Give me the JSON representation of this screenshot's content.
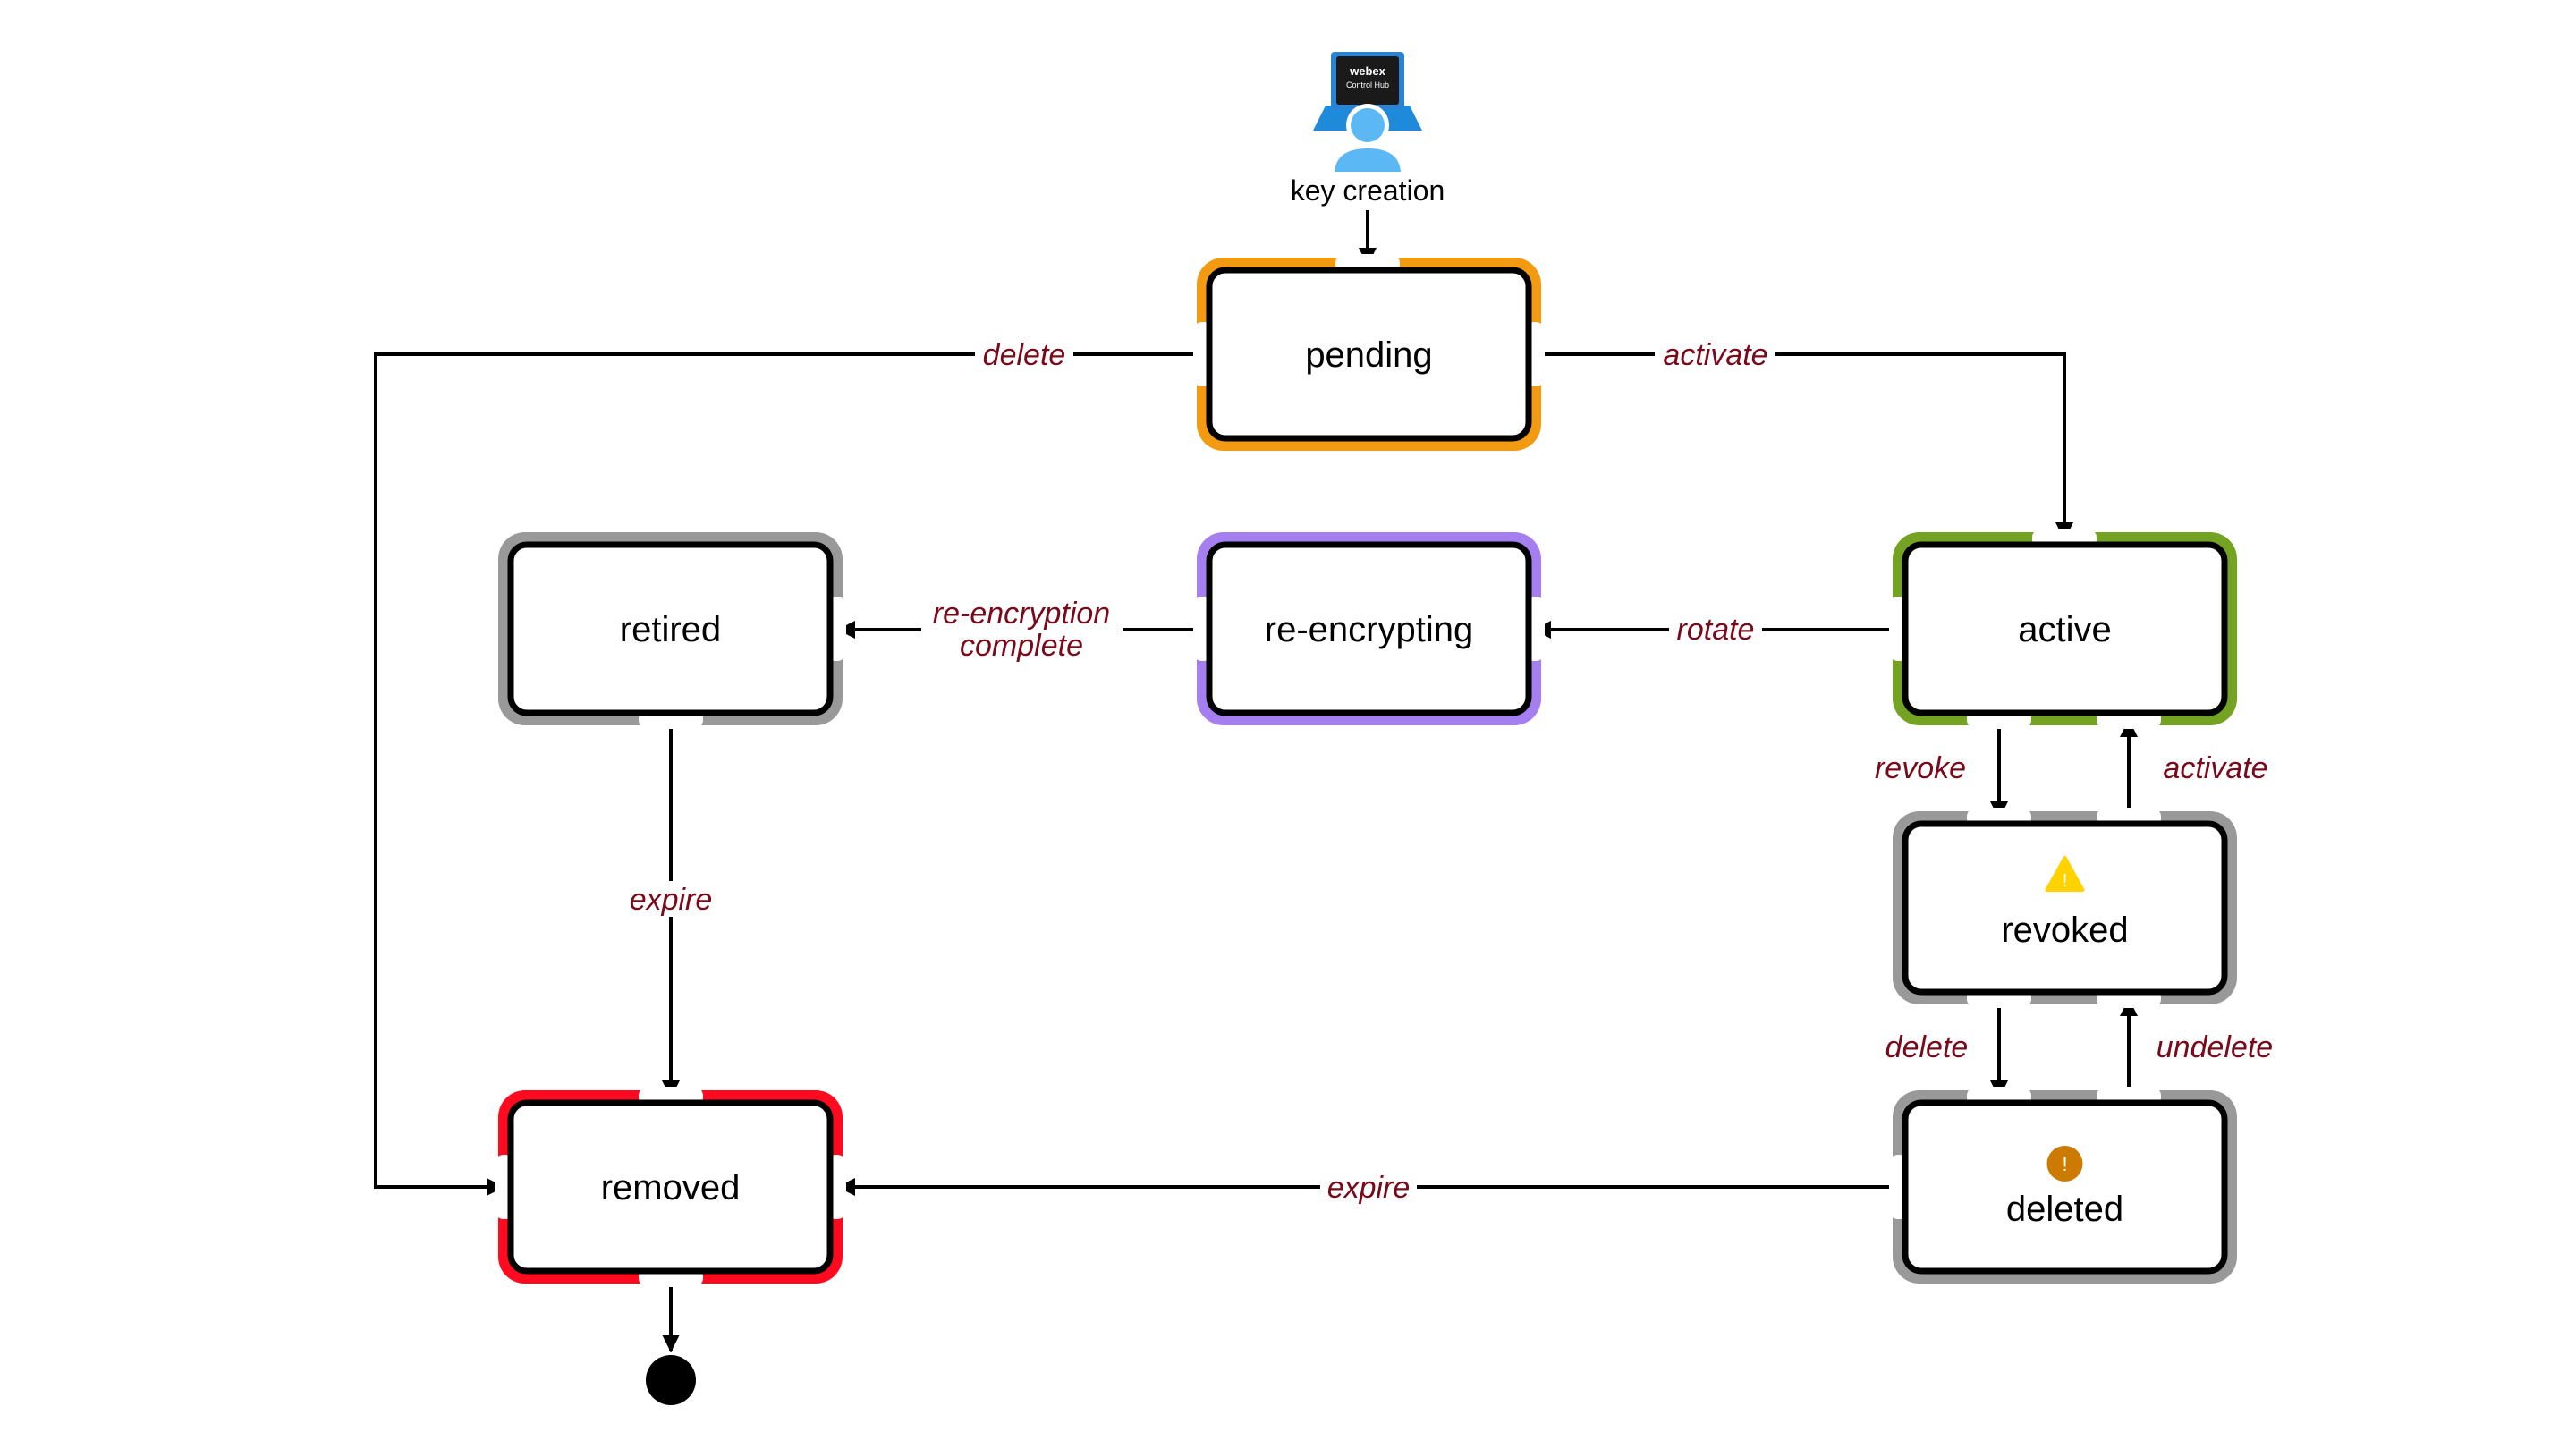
{
  "diagram": {
    "start": {
      "label": "key creation",
      "icon": "webex-control-hub-admin-icon",
      "icon_screen_title": "webex",
      "icon_screen_subtitle": "Control Hub"
    },
    "states": {
      "pending": {
        "label": "pending",
        "color": "#f29a11"
      },
      "retired": {
        "label": "retired",
        "color": "#999999"
      },
      "re_encrypting": {
        "label": "re-encrypting",
        "color": "#a57ff0"
      },
      "active": {
        "label": "active",
        "color": "#74a324"
      },
      "revoked": {
        "label": "revoked",
        "color": "#999999",
        "icon": "warning-triangle-icon",
        "icon_color": "#ffd200"
      },
      "deleted": {
        "label": "deleted",
        "color": "#999999",
        "icon": "alert-circle-icon",
        "icon_color": "#cc7a00"
      },
      "removed": {
        "label": "removed",
        "color": "#ff0a1e"
      }
    },
    "transitions": {
      "pending_delete": "delete",
      "pending_activate": "activate",
      "active_rotate": "rotate",
      "reencrypt_complete_line1": "re-encryption",
      "reencrypt_complete_line2": "complete",
      "retired_expire": "expire",
      "active_revoke": "revoke",
      "revoked_activate": "activate",
      "revoked_delete": "delete",
      "deleted_undelete": "undelete",
      "deleted_expire": "expire"
    },
    "edge_label_color": "#7a0a1a"
  }
}
